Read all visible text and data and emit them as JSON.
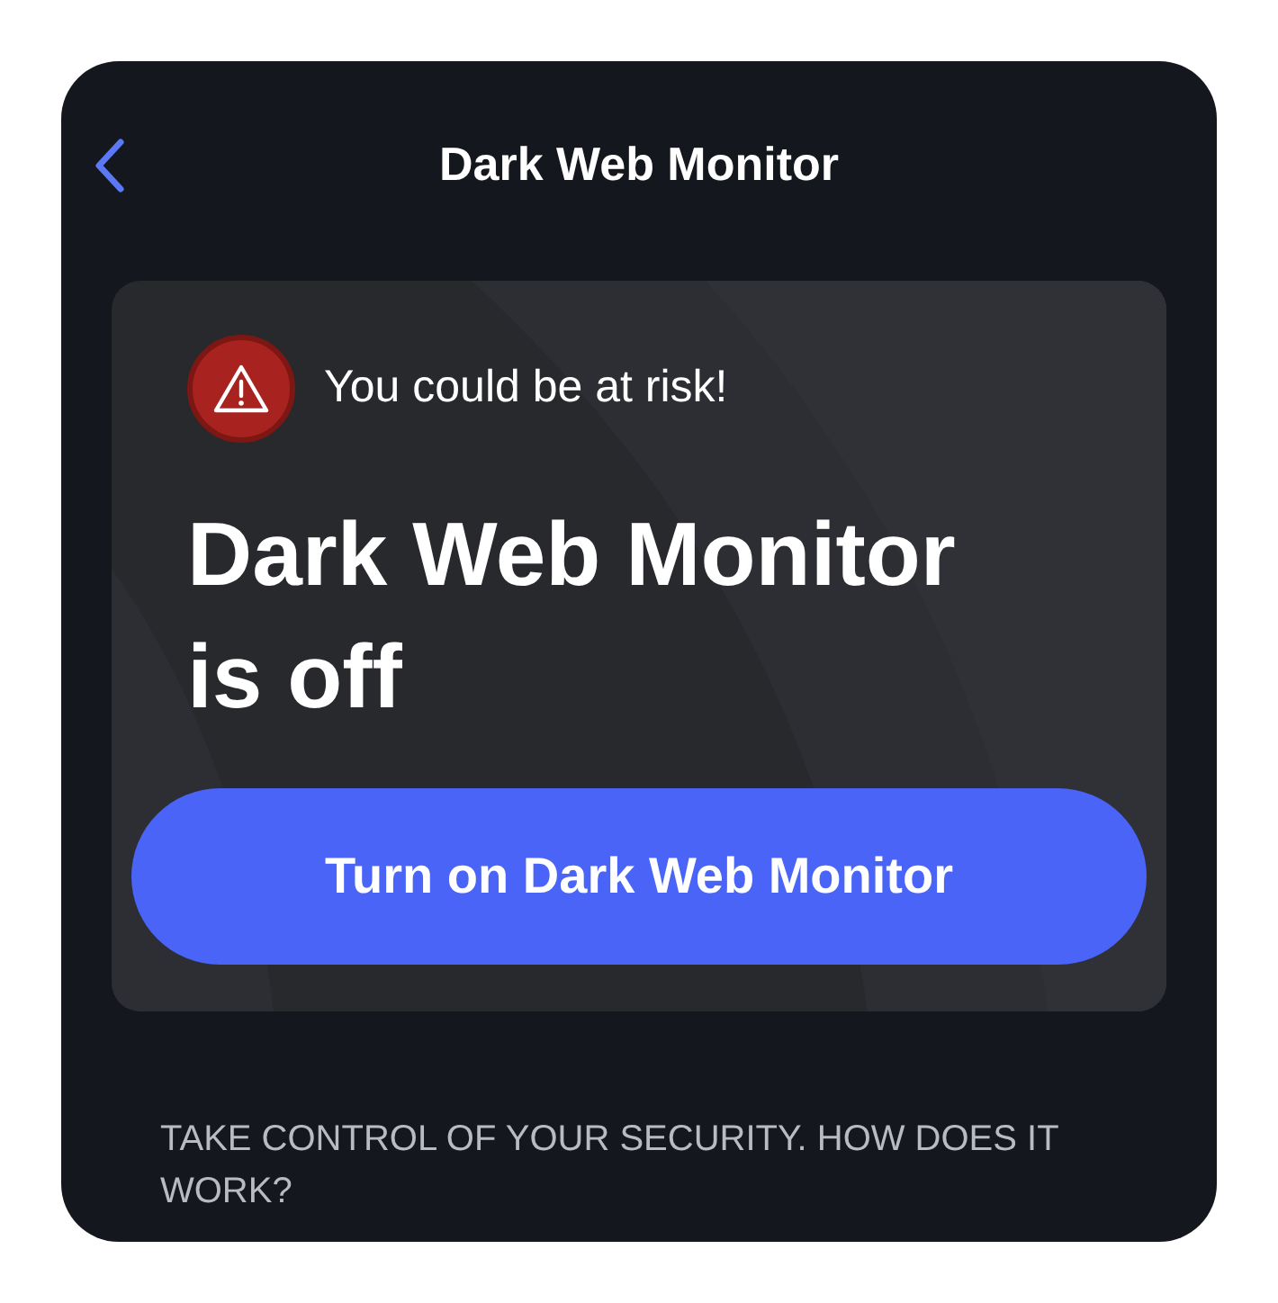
{
  "header": {
    "title": "Dark Web Monitor"
  },
  "alert_card": {
    "warning": "You could be at risk!",
    "headline": "Dark Web Monitor is off",
    "button": "Turn on Dark Web Monitor"
  },
  "footer": {
    "text": "TAKE CONTROL OF YOUR SECURITY. HOW DOES IT WORK?"
  }
}
